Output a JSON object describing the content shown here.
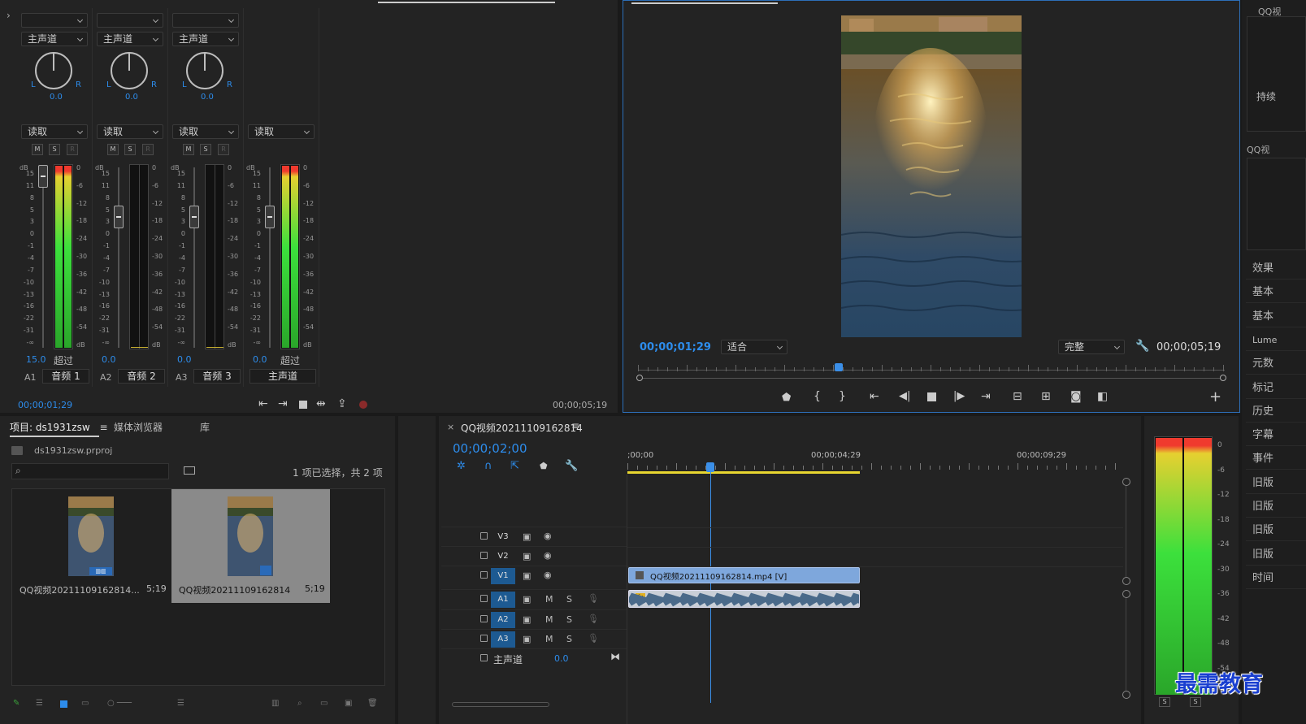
{
  "audio_mixer": {
    "channels": [
      {
        "route": "主声道",
        "pan_value": "0.0",
        "automation": "读取",
        "level": "15.0",
        "overflow": "超过",
        "track_id": "A1",
        "name": "音频 1"
      },
      {
        "route": "主声道",
        "pan_value": "0.0",
        "automation": "读取",
        "level": "0.0",
        "track_id": "A2",
        "name": "音频 2"
      },
      {
        "route": "主声道",
        "pan_value": "0.0",
        "automation": "读取",
        "level": "0.0",
        "track_id": "A3",
        "name": "音频 3"
      },
      {
        "automation": "读取",
        "level": "0.0",
        "overflow": "超过",
        "name": "主声道"
      }
    ],
    "pan_l": "L",
    "pan_r": "R",
    "mute": "M",
    "solo": "S",
    "record": "R",
    "db_label": "dB",
    "left_scale": [
      "15",
      "11",
      "8",
      "5",
      "3",
      "0",
      "-1",
      "-4",
      "-7",
      "-10",
      "-13",
      "-16",
      "-22",
      "-31",
      "-∞"
    ],
    "right_scale": [
      "0",
      "-6",
      "-12",
      "-18",
      "-24",
      "-30",
      "-36",
      "-42",
      "-48",
      "-54",
      "dB"
    ],
    "current_time": "00;00;01;29",
    "duration": "00;00;05;19"
  },
  "program_monitor": {
    "current_time": "00;00;01;29",
    "zoom": "适合",
    "quality": "完整",
    "duration": "00;00;05;19",
    "playhead_fraction": 0.34
  },
  "project_panel": {
    "tabs": [
      "项目: ds1931zsw",
      "媒体浏览器",
      "库"
    ],
    "project_file": "ds1931zsw.prproj",
    "selection_status": "1 项已选择，共 2 项",
    "items": [
      {
        "name": "QQ视频20211109162814...",
        "duration": "5;19"
      },
      {
        "name": "QQ视频20211109162814",
        "duration": "5;19"
      }
    ]
  },
  "timeline": {
    "sequence_name": "QQ视频20211109162814",
    "timecode": "00;00;02;00",
    "ruler": [
      ";00;00",
      "00;00;04;29",
      "00;00;09;29"
    ],
    "video_tracks": [
      "V3",
      "V2",
      "V1"
    ],
    "audio_tracks": [
      "A1",
      "A2",
      "A3"
    ],
    "master_label": "主声道",
    "master_value": "0.0",
    "mute": "M",
    "solo": "S",
    "video_clip": "QQ视频20211109162814.mp4 [V]",
    "audio_clip_badge": "fx"
  },
  "master_meter": {
    "scale": [
      "0",
      "-6",
      "-12",
      "-18",
      "-24",
      "-30",
      "-36",
      "-42",
      "-48",
      "-54"
    ],
    "solo_left": "S",
    "solo_right": "S"
  },
  "right_panel": {
    "top_label": "QQ视",
    "header2": "QQ视",
    "partial": "持续",
    "items": [
      "效果",
      "基本",
      "基本",
      "Lume",
      "元数",
      "标记",
      "历史",
      "字幕",
      "事件",
      "旧版",
      "旧版",
      "旧版",
      "旧版",
      "时间"
    ]
  },
  "watermark": "最需教育",
  "colors": {
    "accent": "#2d8ceb",
    "video_clip": "#7ea7dc",
    "audio_clip": "#c9cfd8",
    "work_area": "#e8d630"
  }
}
